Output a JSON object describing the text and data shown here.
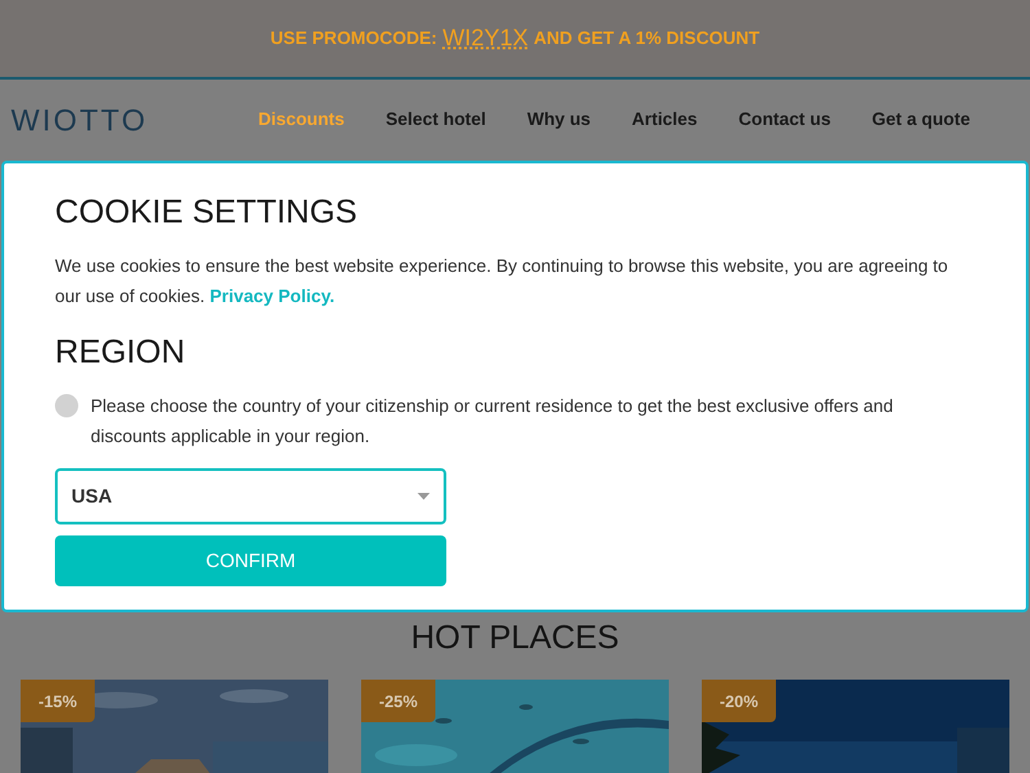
{
  "promo": {
    "prefix": "USE PROMOCODE:",
    "code": "WI2Y1X",
    "suffix": "AND GET A 1% DISCOUNT"
  },
  "logo": "WIOTTO",
  "nav": [
    {
      "label": "Discounts",
      "selected": true
    },
    {
      "label": "Select hotel",
      "selected": false
    },
    {
      "label": "Why us",
      "selected": false
    },
    {
      "label": "Articles",
      "selected": false
    },
    {
      "label": "Contact us",
      "selected": false
    },
    {
      "label": "Get a quote",
      "selected": false
    }
  ],
  "cookie_modal": {
    "title": "COOKIE SETTINGS",
    "text": "We use cookies to ensure the best website experience. By continuing to browse this website, you are agreeing to our use of cookies.",
    "link": "Privacy Policy.",
    "region_title": "REGION",
    "region_option": {
      "label": "Please choose the country of your citizenship or current residence to get the best exclusive offers and discounts applicable in your region.",
      "checked": false
    },
    "country": "USA",
    "button": "CONFIRM"
  },
  "hot_places": {
    "title": "HOT PLACES",
    "cards": [
      {
        "discount": "-15%"
      },
      {
        "discount": "-25%"
      },
      {
        "discount": "-20%"
      }
    ]
  }
}
